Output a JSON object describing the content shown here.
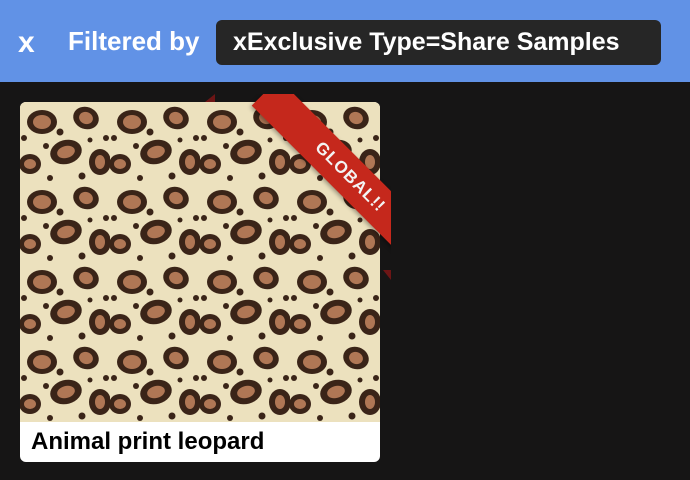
{
  "filter_bar": {
    "clear_label": "x",
    "label": "Filtered by",
    "chip_text": "xExclusive Type=Share Samples",
    "background": "#6192e6"
  },
  "cards": [
    {
      "title": "Animal print leopard",
      "ribbon_text": "GLOBAL!!",
      "ribbon_color": "#c5281c",
      "image": "leopard-print-pattern"
    }
  ]
}
